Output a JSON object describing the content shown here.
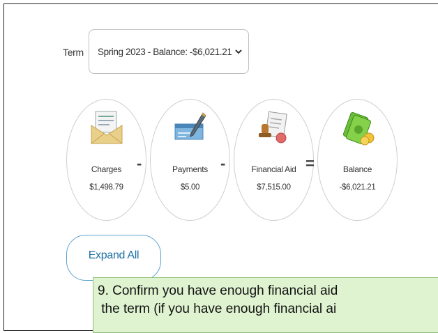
{
  "term": {
    "label": "Term",
    "selected": "Spring 2023 - Balance: -$6,021.21"
  },
  "summary": [
    {
      "name": "Charges",
      "amount": "$1,498.79",
      "icon": "envelope-bill-icon"
    },
    {
      "name": "Payments",
      "amount": "$5.00",
      "icon": "check-pen-icon"
    },
    {
      "name": "Financial Aid",
      "amount": "$7,515.00",
      "icon": "document-stamp-icon"
    },
    {
      "name": "Balance",
      "amount": "-$6,021.21",
      "icon": "money-stack-icon"
    }
  ],
  "operators": [
    "-",
    "-",
    "="
  ],
  "expand_all_label": "Expand All",
  "callout": {
    "line1": "9. Confirm you have enough financial aid",
    "line2": " the term (if you have enough financial ai"
  },
  "colors": {
    "button_border": "#5fa4cf",
    "button_text": "#1c6fa3",
    "callout_bg": "#dff3d0"
  }
}
